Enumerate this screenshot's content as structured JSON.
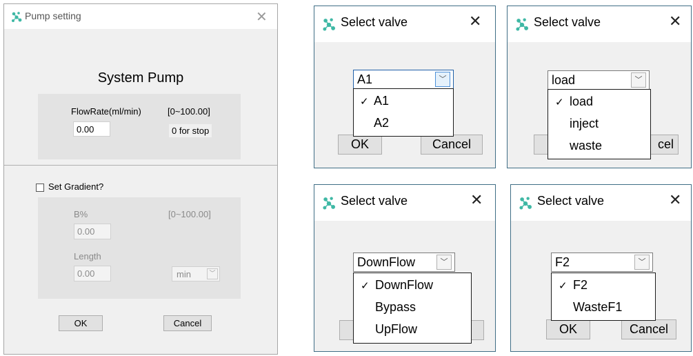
{
  "pump": {
    "title": "Pump setting",
    "heading": "System Pump",
    "flow_label": "FlowRate(ml/min)",
    "flow_range": "[0~100.00]",
    "flow_value": "0.00",
    "stop_hint": "0 for stop",
    "gradient_label": "Set Gradient?",
    "gradient_checked": false,
    "b_label": "B%",
    "b_range": "[0~100.00]",
    "b_value": "0.00",
    "length_label": "Length",
    "length_value": "0.00",
    "unit_value": "min",
    "ok_label": "OK",
    "cancel_label": "Cancel"
  },
  "valve_dialogs": [
    {
      "title": "Select valve",
      "selected": "A1",
      "options": [
        "A1",
        "A2"
      ],
      "ok_label": "OK",
      "cancel_label": "Cancel"
    },
    {
      "title": "Select valve",
      "selected": "load",
      "options": [
        "load",
        "inject",
        "waste"
      ],
      "cancel_partial": "cel"
    },
    {
      "title": "Select valve",
      "selected": "DownFlow",
      "options": [
        "DownFlow",
        "Bypass",
        "UpFlow"
      ]
    },
    {
      "title": "Select valve",
      "selected": "F2",
      "options": [
        "F2",
        "WasteF1"
      ],
      "ok_label": "OK",
      "cancel_label": "Cancel"
    }
  ],
  "icons": {
    "close": "close-icon",
    "app": "app-molecule-icon",
    "dropdown_arrow": "chevron-down-icon",
    "checkmark": "checkmark-icon"
  },
  "colors": {
    "app_icon": "#3fb8a5",
    "valve_border": "#3f6d85",
    "focus_blue": "#1f5fa8"
  }
}
